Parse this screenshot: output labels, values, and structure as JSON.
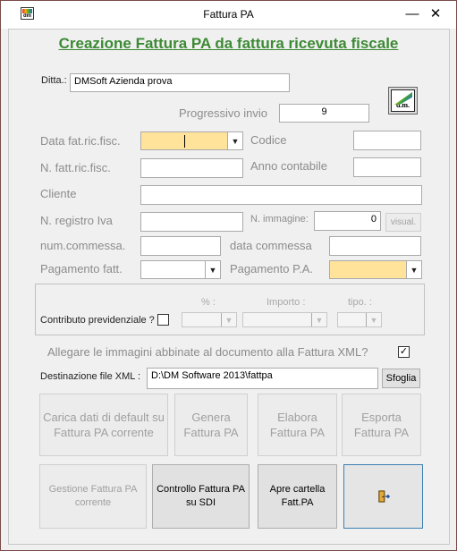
{
  "window": {
    "title": "Fattura PA",
    "minimize": "—",
    "close": "✕",
    "app_icon": "dm"
  },
  "heading": "Creazione Fattura PA da fattura ricevuta fiscale",
  "ditta": {
    "label": "Ditta.:",
    "value": "DMSoft Azienda prova"
  },
  "progressivo": {
    "label": "Progressivo invio",
    "value": "9"
  },
  "logo": {
    "text": "d.m."
  },
  "labels": {
    "data_fat": "Data fat.ric.fisc.",
    "codice": "Codice",
    "n_fatt": "N. fatt.ric.fisc.",
    "anno": "Anno contabile",
    "cliente": "Cliente",
    "n_registro": "N. registro Iva",
    "n_immagine": "N. immagine:",
    "num_commessa": "num.commessa.",
    "data_commessa": "data commessa",
    "pagamento_fatt": "Pagamento fatt.",
    "pagamento_pa": "Pagamento P.A."
  },
  "fields": {
    "n_immagine": "0",
    "visual_button": "visual."
  },
  "contributo": {
    "label": "Contributo previdenziale ?",
    "percent_label": "% :",
    "importo_label": "Importo :",
    "tipo_label": "tipo. :"
  },
  "allegare": {
    "label": "Allegare le immagini abbinate al documento alla Fattura XML?",
    "checked": "✓"
  },
  "destinazione": {
    "label": "Destinazione file XML :",
    "value": "D:\\DM Software 2013\\fattpa",
    "browse": "Sfoglia"
  },
  "buttons": {
    "carica": "Carica dati di default su  Fattura PA corrente",
    "genera": "Genera Fattura PA",
    "elabora": "Elabora Fattura PA",
    "esporta": "Esporta Fattura PA",
    "gestione": "Gestione Fattura PA corrente",
    "controllo": "Controllo Fattura PA su SDI",
    "apre": "Apre cartella Fatt.PA"
  },
  "colors": {
    "heading": "#3c8a34",
    "required_field": "#ffe39b"
  }
}
